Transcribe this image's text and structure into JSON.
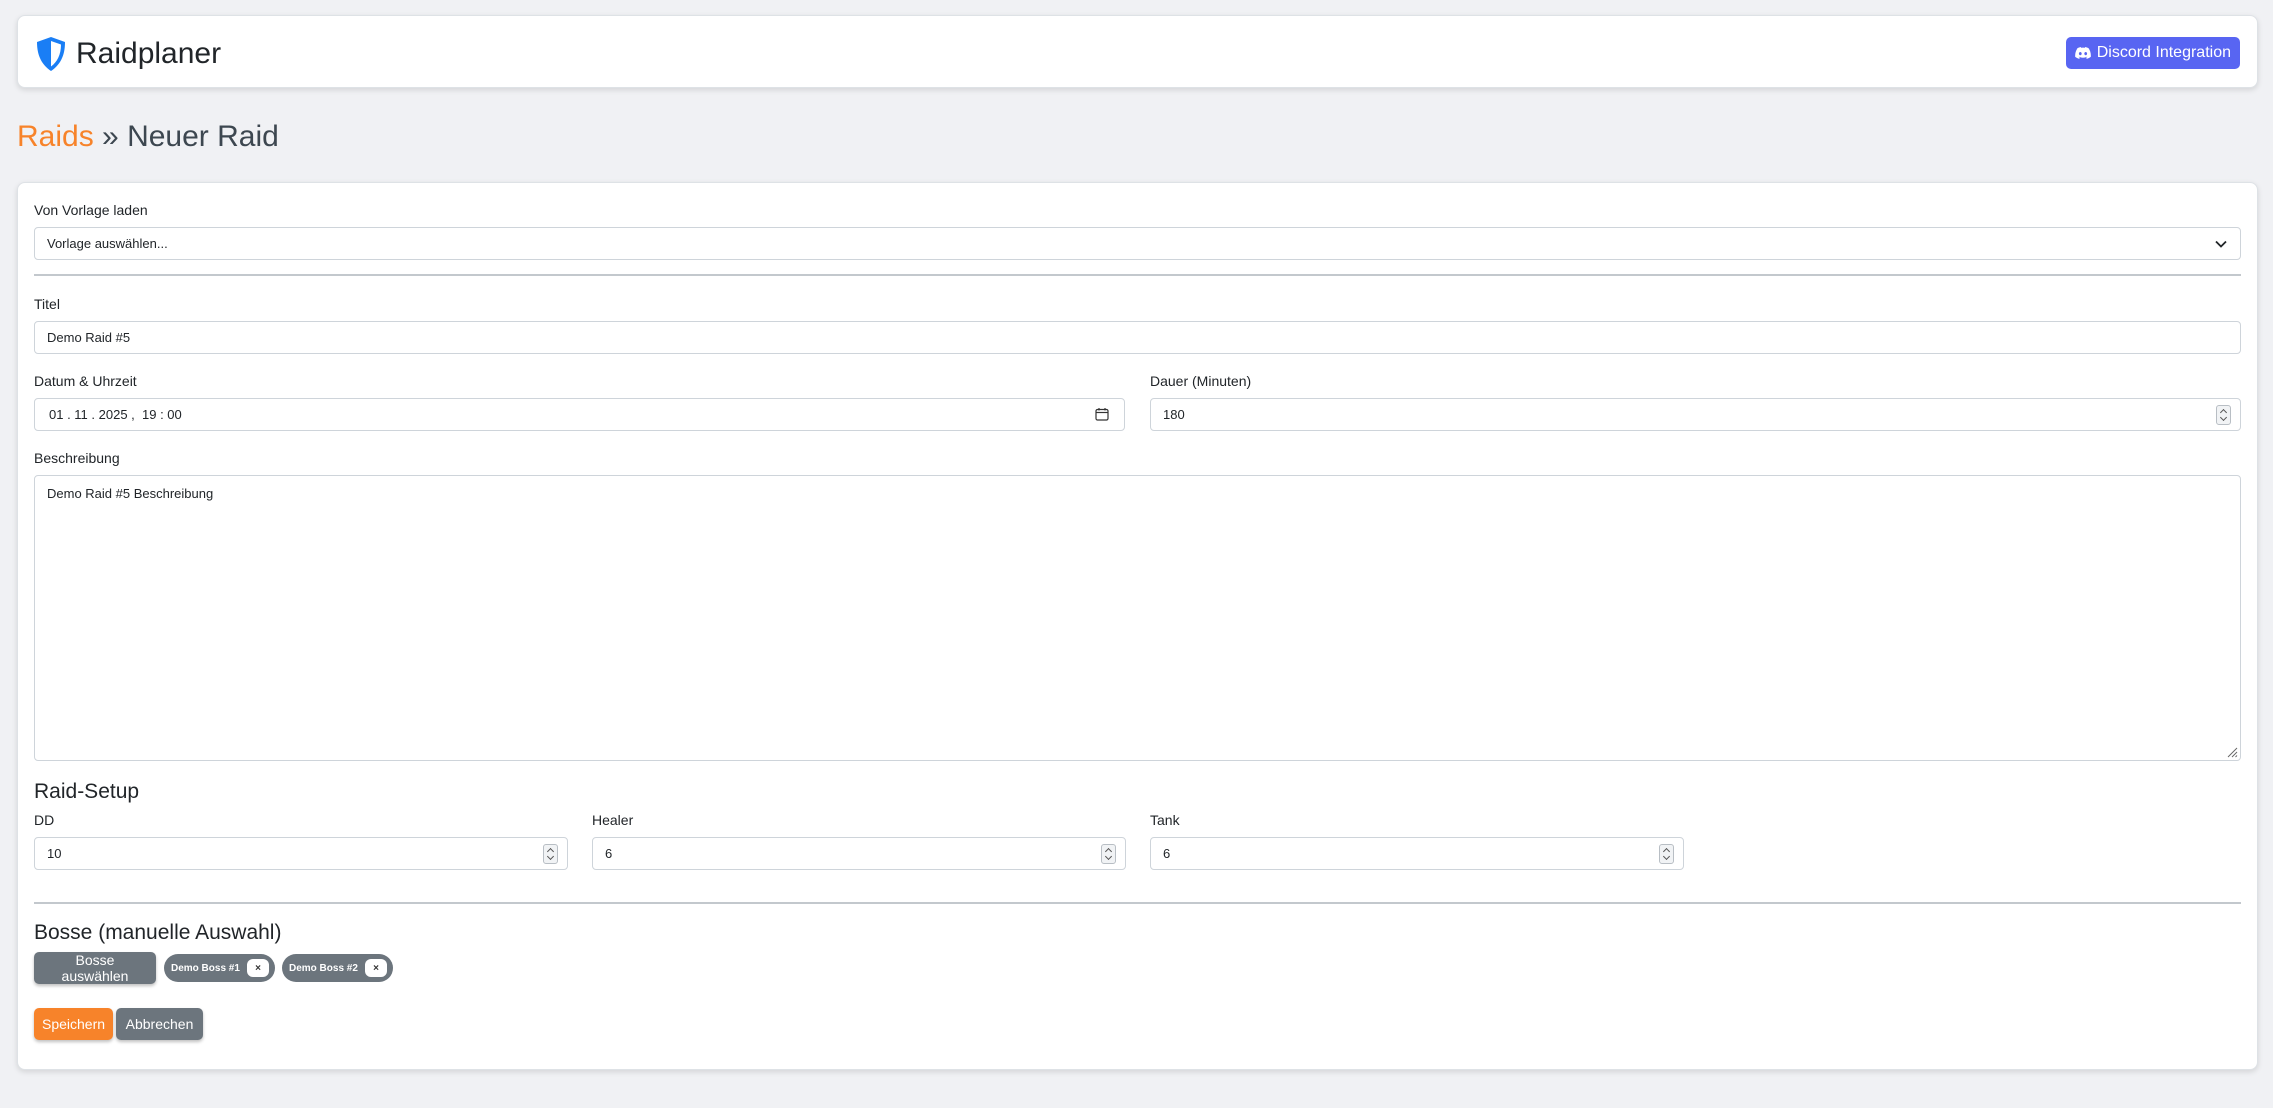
{
  "header": {
    "brand": "Raidplaner",
    "discord_button": "Discord Integration",
    "icons": {
      "brand": "shield-icon",
      "discord": "discord-icon"
    }
  },
  "breadcrumb": {
    "parent": "Raids",
    "separator": "»",
    "current": "Neuer Raid"
  },
  "colors": {
    "accent": "#f7832a",
    "discord": "#5865f2",
    "brand_blue": "#1a7ef5",
    "secondary": "#6c757d"
  },
  "form": {
    "template": {
      "label": "Von Vorlage laden",
      "value": "Vorlage auswählen..."
    },
    "title": {
      "label": "Titel",
      "value": "Demo Raid #5"
    },
    "datetime": {
      "label": "Datum & Uhrzeit",
      "value": "01 . 11 . 2025 ,  19 : 00"
    },
    "duration": {
      "label": "Dauer (Minuten)",
      "value": "180"
    },
    "description": {
      "label": "Beschreibung",
      "value": "Demo Raid #5 Beschreibung"
    },
    "setup": {
      "title": "Raid-Setup",
      "dd": {
        "label": "DD",
        "value": "10"
      },
      "healer": {
        "label": "Healer",
        "value": "6"
      },
      "tank": {
        "label": "Tank",
        "value": "6"
      }
    },
    "bosses": {
      "title": "Bosse (manuelle Auswahl)",
      "select_button": "Bosse auswählen",
      "selected": [
        {
          "name": "Demo Boss #1",
          "remove": "×"
        },
        {
          "name": "Demo Boss #2",
          "remove": "×"
        }
      ]
    },
    "save_button": "Speichern",
    "cancel_button": "Abbrechen"
  }
}
